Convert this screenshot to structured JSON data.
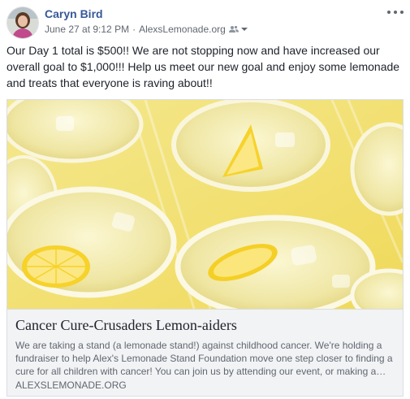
{
  "post": {
    "author": "Caryn Bird",
    "date": "June 27 at 9:12 PM",
    "separator": "·",
    "site": "AlexsLemonade.org",
    "privacy_icon": "friends-icon",
    "more_icon": "more-options-icon",
    "text": "Our Day 1 total is $500!! We are not stopping now and have increased our overall goal to $1,000!!! Help us meet our new goal and enjoy some lemonade and treats that everyone is raving about!!"
  },
  "link_card": {
    "image_icon": "lemonade-cups-photo",
    "title": "Cancer Cure-Crusaders Lemon-aiders",
    "description": "We are taking a stand (a lemonade stand!) against childhood cancer. We're holding a fundraiser to help Alex's Lemonade Stand Foundation move one step closer to finding a cure for all children with cancer! You can join us by attending our event, or making a…",
    "domain": "ALEXSLEMONADE.ORG"
  },
  "colors": {
    "author_link": "#365899",
    "meta_text": "#616770",
    "card_bg": "#f2f3f5",
    "lemonade": "#f3e7a0"
  }
}
